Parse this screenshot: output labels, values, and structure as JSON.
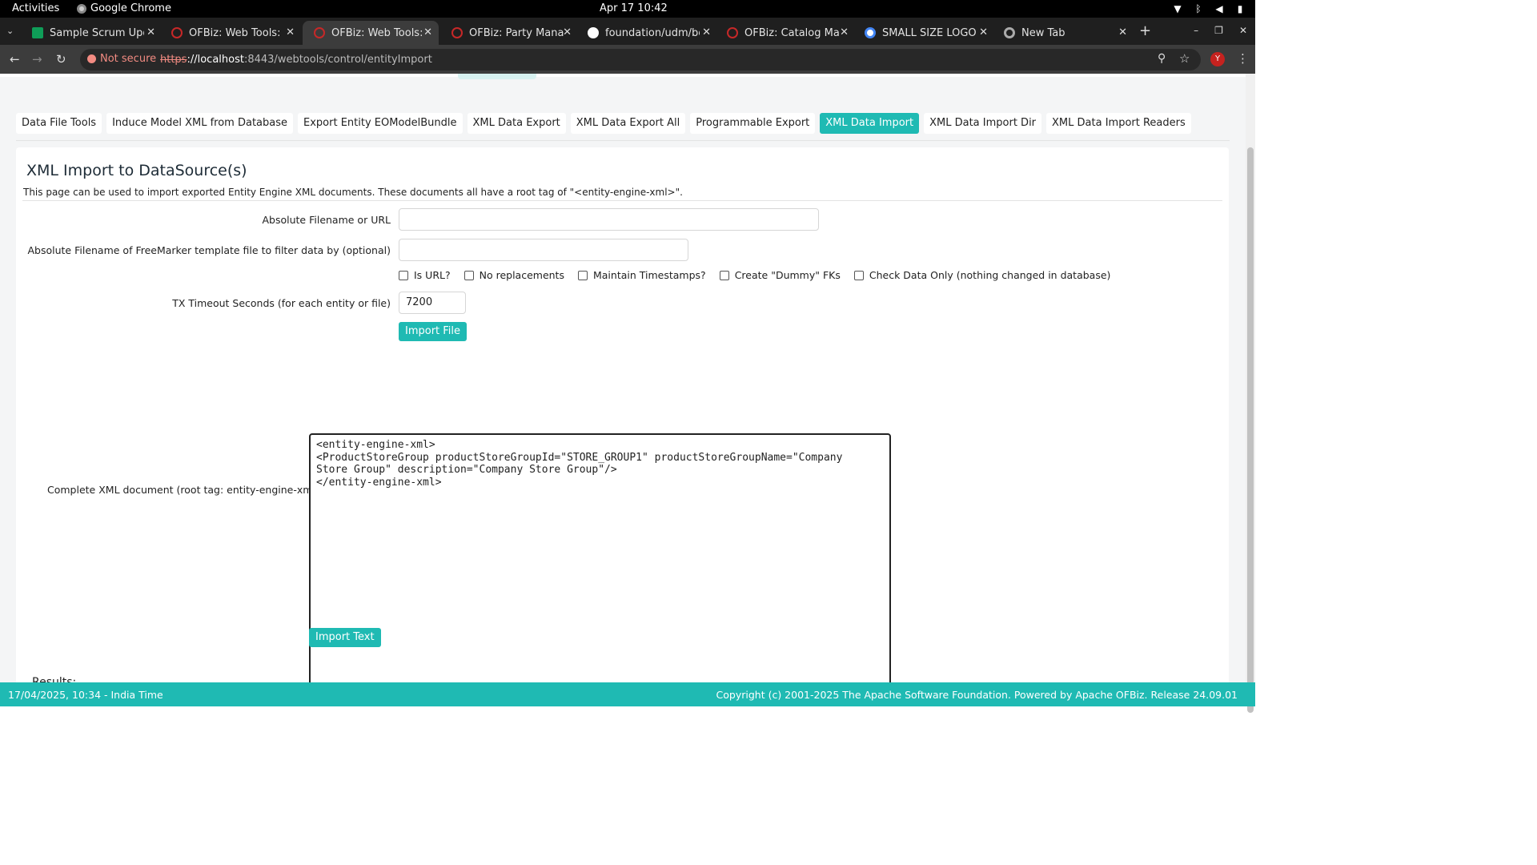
{
  "system": {
    "activities": "Activities",
    "app_name": "Google Chrome",
    "clock": "Apr 17  10:42"
  },
  "browser": {
    "tabs": [
      {
        "title": "Sample Scrum Updat",
        "icon": "sheets-icon",
        "color": "#0f9d58"
      },
      {
        "title": "OFBiz: Web Tools: Vi",
        "icon": "ofbiz-icon",
        "color": "#c62828"
      },
      {
        "title": "OFBiz: Web Tools: XI",
        "icon": "ofbiz-icon",
        "color": "#c62828"
      },
      {
        "title": "OFBiz: Party Manage",
        "icon": "ofbiz-icon",
        "color": "#c62828"
      },
      {
        "title": "foundation/udm/be",
        "icon": "github-icon",
        "color": "#ffffff"
      },
      {
        "title": "OFBiz: Catalog Mana",
        "icon": "ofbiz-icon",
        "color": "#c62828"
      },
      {
        "title": "SMALL SIZE LOGOG I",
        "icon": "google-icon",
        "color": "#4285f4"
      },
      {
        "title": "New Tab",
        "icon": "chrome-icon",
        "color": "#aaaaaa"
      }
    ],
    "not_secure": "Not secure",
    "url_scheme": "https",
    "url_host": "://localhost",
    "url_rest": ":8443/webtools/control/entityImport",
    "avatar_letter": "Y"
  },
  "subtabs": [
    "Data File Tools",
    "Induce Model XML from Database",
    "Export Entity EOModelBundle",
    "XML Data Export",
    "XML Data Export All",
    "Programmable Export",
    "XML Data Import",
    "XML Data Import Dir",
    "XML Data Import Readers"
  ],
  "active_subtab": "XML Data Import",
  "form": {
    "title": "XML Import to DataSource(s)",
    "description": "This page can be used to import exported Entity Engine XML documents. These documents all have a root tag of \"<entity-engine-xml>\".",
    "filename_label": "Absolute Filename or URL",
    "filename_value": "",
    "template_label": "Absolute Filename of FreeMarker template file to filter data by (optional)",
    "template_value": "",
    "checkboxes": [
      "Is URL?",
      "No replacements",
      "Maintain Timestamps?",
      "Create \"Dummy\" FKs",
      "Check Data Only (nothing changed in database)"
    ],
    "timeout_label": "TX Timeout Seconds (for each entity or file)",
    "timeout_value": "7200",
    "import_file_button": "Import File",
    "xml_label": "Complete XML document (root tag: entity-engine-xml)",
    "xml_value": "<entity-engine-xml>\n<ProductStoreGroup productStoreGroupId=\"STORE_GROUP1\" productStoreGroupName=\"Company\nStore Group\" description=\"Company Store Group\"/>\n</entity-engine-xml>",
    "import_text_button": "Import Text",
    "results_label": "Results:"
  },
  "footer": {
    "left": "17/04/2025, 10:34 - India Time",
    "right": "Copyright (c) 2001-2025 The Apache Software Foundation. Powered by Apache OFBiz. Release 24.09.01"
  },
  "colors": {
    "accent": "#1fbab3",
    "footer": "#1fbab3"
  }
}
